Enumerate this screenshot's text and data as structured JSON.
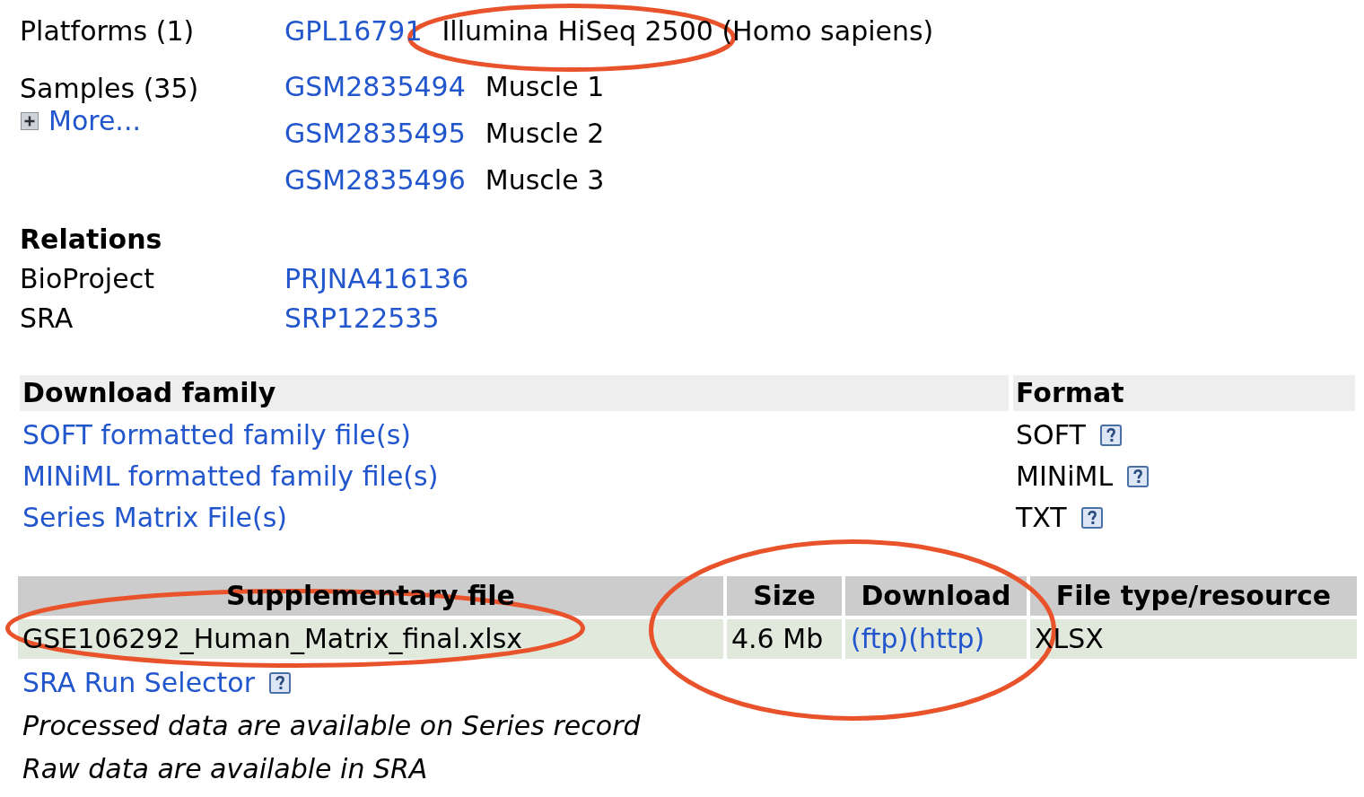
{
  "platforms": {
    "label": "Platforms (1)",
    "items": [
      {
        "accession": "GPL16791",
        "title": "Illumina HiSeq 2500 (Homo sapiens)",
        "circled": true
      }
    ]
  },
  "samples": {
    "label": "Samples (35)",
    "more_link": "More...",
    "items": [
      {
        "accession": "GSM2835494",
        "title": "Muscle 1"
      },
      {
        "accession": "GSM2835495",
        "title": "Muscle 2"
      },
      {
        "accession": "GSM2835496",
        "title": "Muscle 3"
      }
    ]
  },
  "relations": {
    "heading": "Relations",
    "items": [
      {
        "label": "BioProject",
        "value": "PRJNA416136"
      },
      {
        "label": "SRA",
        "value": "SRP122535"
      }
    ]
  },
  "download_family": {
    "columns": [
      "Download family",
      "Format"
    ],
    "rows": [
      {
        "link": "SOFT formatted family file(s)",
        "format": "SOFT"
      },
      {
        "link": "MINiML formatted family file(s)",
        "format": "MINiML"
      },
      {
        "link": "Series Matrix File(s)",
        "format": "TXT"
      }
    ]
  },
  "supplementary": {
    "columns": [
      "Supplementary file",
      "Size",
      "Download",
      "File type/resource"
    ],
    "rows": [
      {
        "file": "GSE106292_Human_Matrix_final.xlsx",
        "size": "4.6 Mb",
        "download_links": [
          "(ftp)",
          "(http)"
        ],
        "file_type": "XLSX",
        "file_circled": true,
        "size_download_circled": true
      }
    ]
  },
  "sra_run_selector": "SRA Run Selector",
  "notes": [
    "Processed data are available on Series record",
    "Raw data are available in SRA"
  ]
}
